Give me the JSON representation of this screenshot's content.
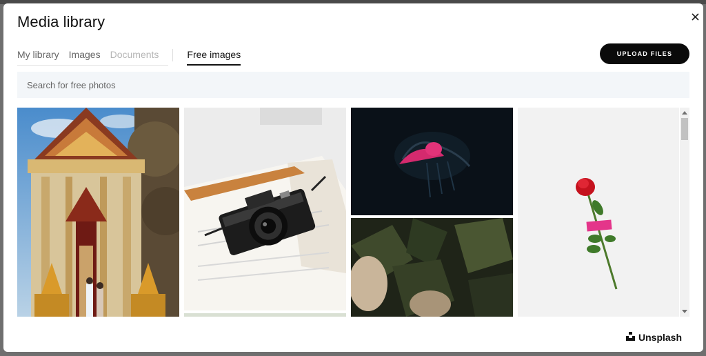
{
  "modal": {
    "title": "Media library",
    "close_icon": "close-icon",
    "tabs": [
      {
        "label": "My library",
        "state": "normal"
      },
      {
        "label": "Images",
        "state": "normal"
      },
      {
        "label": "Documents",
        "state": "disabled"
      }
    ],
    "active_tab": {
      "label": "Free images"
    },
    "upload_label": "UPLOAD FILES",
    "search": {
      "placeholder": "Search for free photos",
      "value": ""
    },
    "photos": [
      {
        "subject": "temple",
        "icon": "photo-temple"
      },
      {
        "subject": "camera on book",
        "icon": "photo-camera"
      },
      {
        "subject": "jellyfish",
        "icon": "photo-jellyfish"
      },
      {
        "subject": "plants",
        "icon": "photo-plants"
      },
      {
        "subject": "rose",
        "icon": "photo-rose"
      }
    ],
    "credit": {
      "label": "Unsplash",
      "icon": "unsplash-logo-icon"
    }
  },
  "colors": {
    "overlay": "#6f6f6f",
    "button_bg": "#0a0a0a",
    "search_bg": "#f3f6f9"
  }
}
